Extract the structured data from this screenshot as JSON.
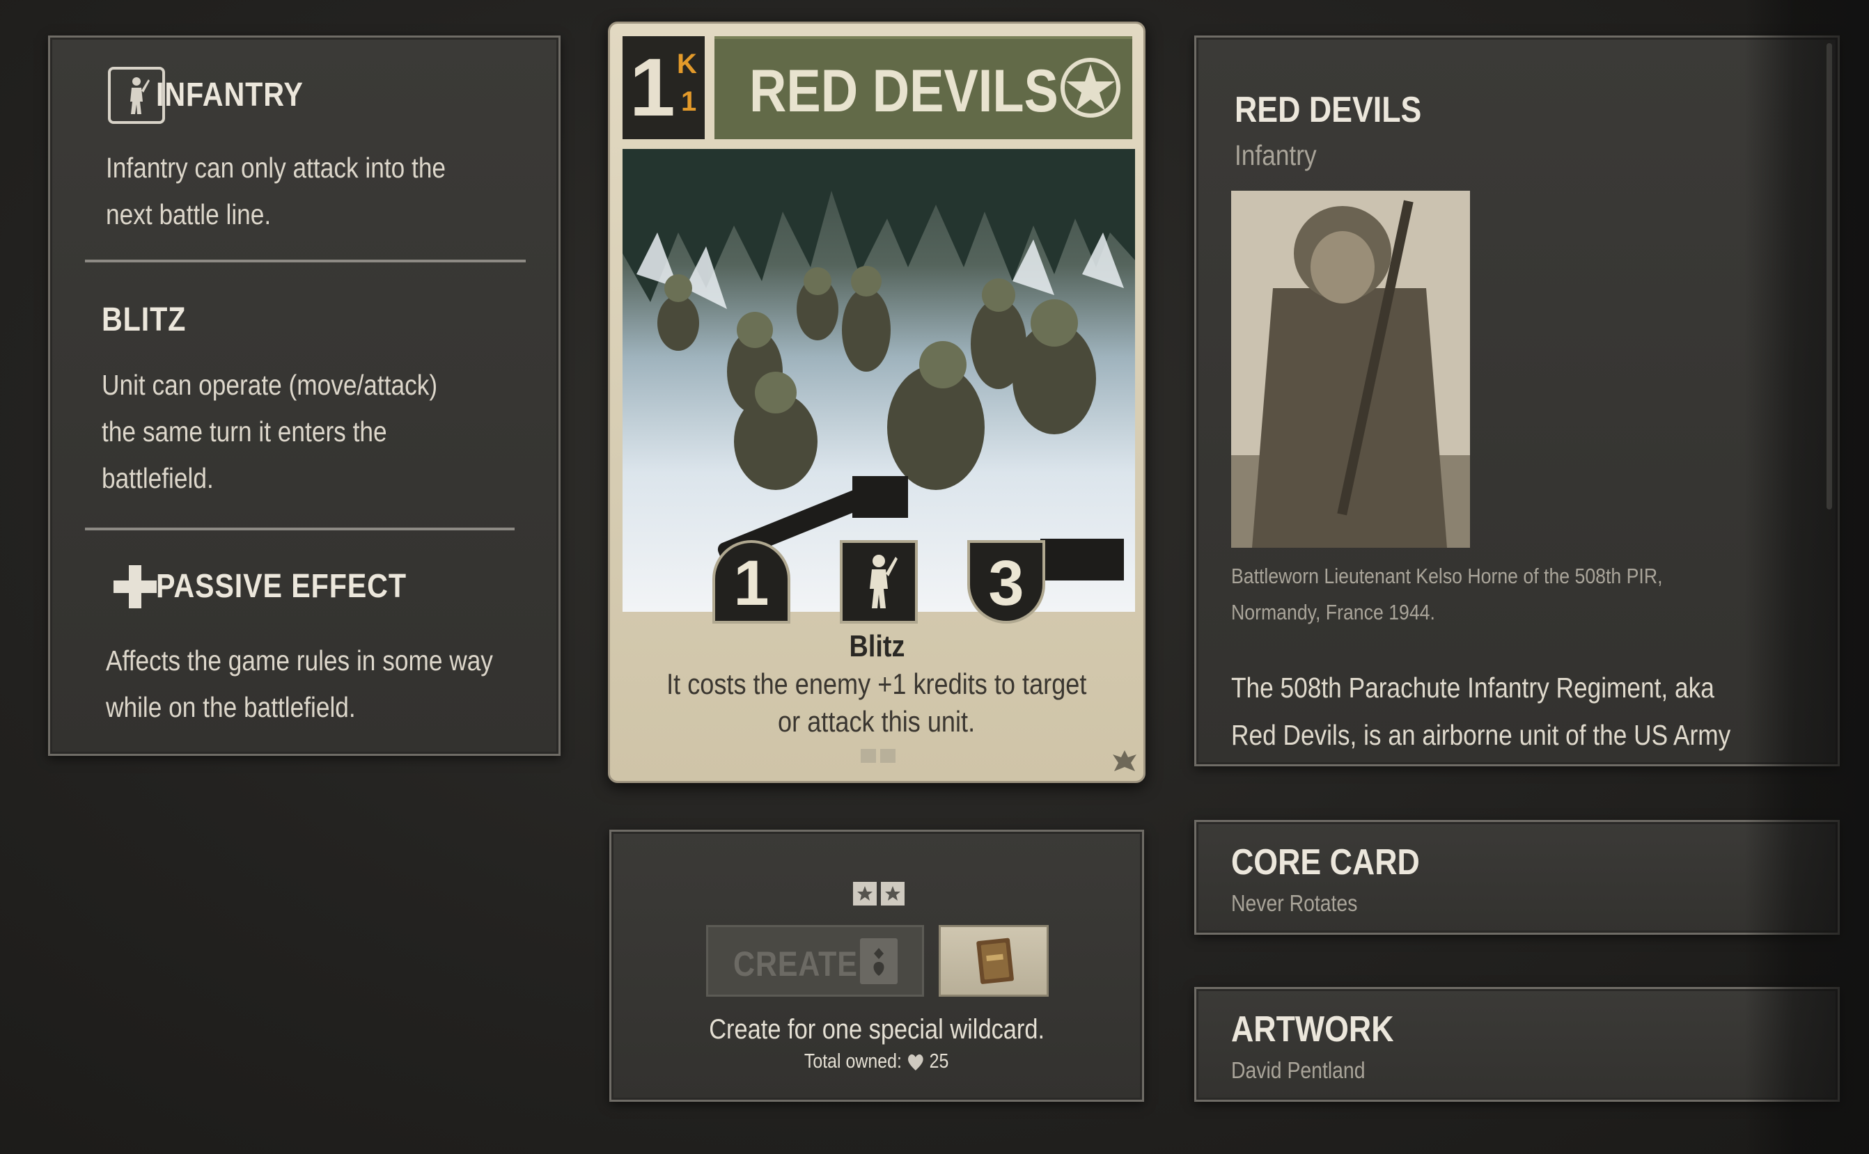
{
  "keywords": [
    {
      "title": "INFANTRY",
      "text_lines": [
        "Infantry can only attack into the",
        "next battle line."
      ]
    },
    {
      "title": "BLITZ",
      "text_lines": [
        "Unit can operate (move/attack)",
        "the same turn it enters the",
        "battlefield."
      ]
    },
    {
      "title": "PASSIVE EFFECT",
      "text_lines": [
        "Affects the game rules in some way",
        "while on the battlefield."
      ]
    }
  ],
  "card": {
    "cost": "1",
    "cost_currency": "K",
    "cost_sub": "1",
    "name": "RED DEVILS",
    "attack": "1",
    "defense": "3",
    "ability_name": "Blitz",
    "ability_lines": [
      "It costs the enemy +1 kredits to target",
      "or attack this unit."
    ]
  },
  "info": {
    "title": "RED DEVILS",
    "subtitle": "Infantry",
    "caption_lines": [
      "Battleworn Lieutenant Kelso Horne of the 508th PIR,",
      "Normandy, France 1944."
    ],
    "description_lines": [
      "The 508th Parachute Infantry Regiment, aka",
      "Red Devils, is an airborne unit of the US Army"
    ]
  },
  "create": {
    "button_label": "CREATE",
    "description": "Create for one special wildcard.",
    "owned_label": "Total owned:",
    "owned_count": "25"
  },
  "core": {
    "title": "CORE CARD",
    "subtitle": "Never Rotates"
  },
  "artwork": {
    "title": "ARTWORK",
    "subtitle": "David Pentland"
  },
  "colors": {
    "name_bar": "#626a48",
    "kredit_orange": "#e39a2a",
    "panel_bg": "#3b3a37",
    "card_bg": "#e2d9c2"
  },
  "icons": [
    "infantry-icon",
    "plus-icon",
    "star-icon",
    "heart-icon",
    "wildcard-icon"
  ]
}
